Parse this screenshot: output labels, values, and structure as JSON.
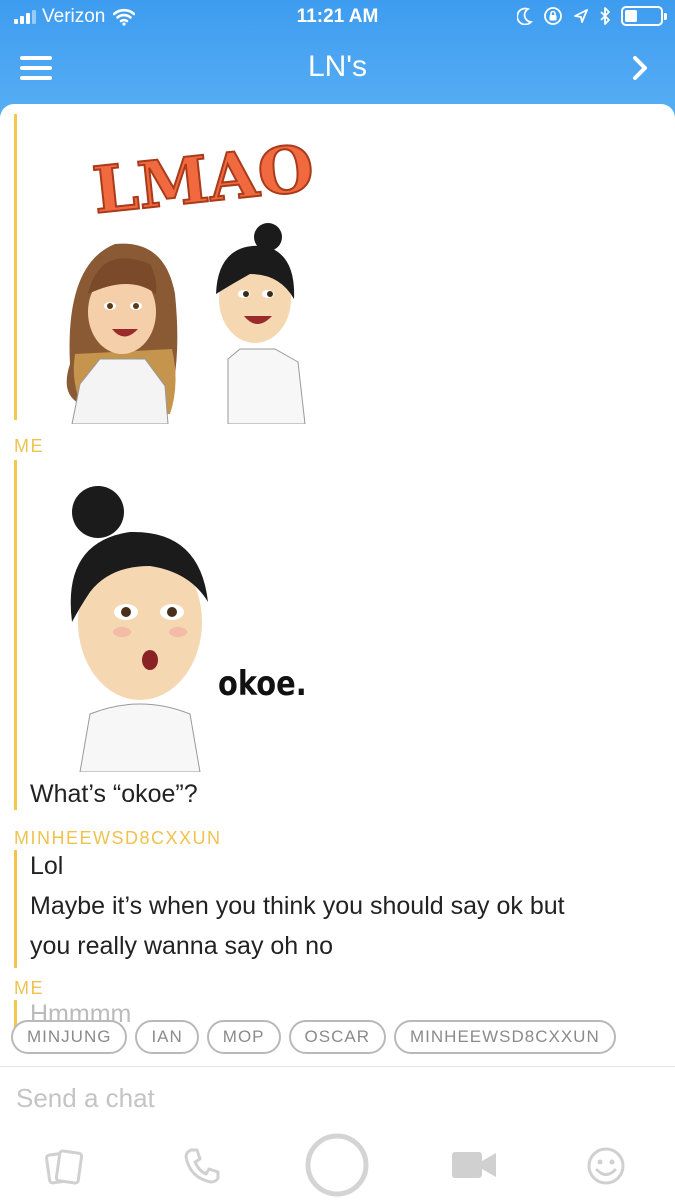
{
  "status": {
    "carrier": "Verizon",
    "time": "11:21 AM"
  },
  "nav": {
    "title": "LN's"
  },
  "messages": [
    {
      "sender": "ME",
      "kind": "bitmoji",
      "caption": "LMAO"
    },
    {
      "sender": "ME",
      "kind": "bitmoji",
      "caption": "okoe."
    },
    {
      "sender": "ME",
      "kind": "text",
      "text": "What’s “okoe”?"
    },
    {
      "sender": "MINHEEWSD8CXXUN",
      "kind": "text",
      "lines": [
        "Lol",
        "Maybe it’s when you think you should say ok but",
        "you really wanna say oh no"
      ]
    },
    {
      "sender": "ME",
      "kind": "text",
      "text": "Hmmmm"
    }
  ],
  "mentions": [
    "MINJUNG",
    "IAN",
    "MOP",
    "OSCAR",
    "MINHEEWSD8CXXUN"
  ],
  "input": {
    "placeholder": "Send a chat"
  },
  "bottom_bar": {
    "icons": [
      "sticker-icon",
      "phone-icon",
      "capture-circle-icon",
      "video-icon",
      "emoji-icon"
    ]
  },
  "colors": {
    "header": "#45a3ec",
    "accent_me": "#f2c94c",
    "accent_friend": "#eec24d"
  }
}
